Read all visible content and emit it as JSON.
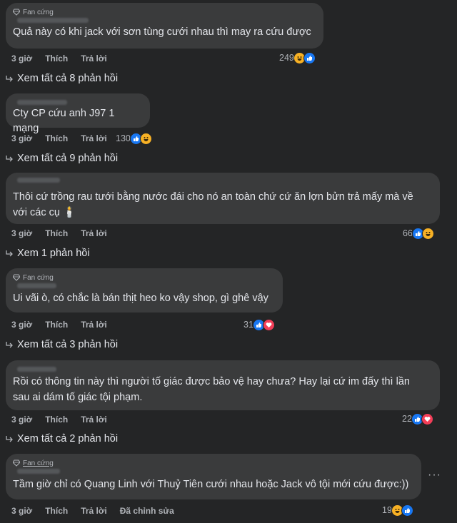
{
  "comments": [
    {
      "badge": "Fan cứng",
      "text": "Quả này có khi jack với sơn tùng cưới nhau thì may ra cứu được",
      "time": "3 giờ",
      "like": "Thích",
      "reply": "Trả lời",
      "reactions_count": "249",
      "reactions": [
        "haha-icon",
        "like-icon"
      ],
      "view_replies": "Xem tất cả 8 phản hồi"
    },
    {
      "badge": "",
      "text": "Cty CP cứu anh J97 1 mạng",
      "time": "3 giờ",
      "like": "Thích",
      "reply": "Trả lời",
      "reactions_count": "130",
      "reactions": [
        "like-icon",
        "haha-icon"
      ],
      "view_replies": "Xem tất cả 9 phản hồi"
    },
    {
      "badge": "",
      "text": "Thôi cứ trồng rau tưới bằng nước đái cho nó an toàn chứ cứ ăn lợn bửn trả mấy mà về\nvới các cụ 🕯️",
      "time": "3 giờ",
      "like": "Thích",
      "reply": "Trả lời",
      "reactions_count": "66",
      "reactions": [
        "like-icon",
        "haha-icon"
      ],
      "view_replies": "Xem 1 phản hồi"
    },
    {
      "badge": "Fan cứng",
      "text": "Ui vãi ò, có chắc là bán thịt heo ko vậy shop, gì ghê vậy",
      "time": "3 giờ",
      "like": "Thích",
      "reply": "Trả lời",
      "reactions_count": "31",
      "reactions": [
        "like-icon",
        "love-icon"
      ],
      "view_replies": "Xem tất cả 3 phản hồi"
    },
    {
      "badge": "",
      "text": "Rồi có thông tin này thì người tố giác được bảo vệ hay chưa? Hay lại cứ im đấy thì lần\nsau ai dám tố giác tội phạm.",
      "time": "3 giờ",
      "like": "Thích",
      "reply": "Trả lời",
      "reactions_count": "22",
      "reactions": [
        "like-icon",
        "love-icon"
      ],
      "view_replies": "Xem tất cả 2 phản hồi"
    },
    {
      "badge": "Fan cứng",
      "text": "Tầm giờ chỉ có Quang Linh với Thuỷ Tiên cưới nhau hoặc Jack vô tội mới cứu được:))",
      "time": "3 giờ",
      "like": "Thích",
      "reply": "Trả lời",
      "edited": "Đã chỉnh sửa",
      "reactions_count": "19",
      "reactions": [
        "haha-icon",
        "like-icon"
      ],
      "more": "···"
    }
  ],
  "colors": {
    "background": "#242526",
    "bubble": "#3a3b3c",
    "text": "#e4e6eb",
    "muted": "#b0b3b8",
    "like": "#1877f2",
    "haha": "#f7b125",
    "love": "#f33e58"
  }
}
